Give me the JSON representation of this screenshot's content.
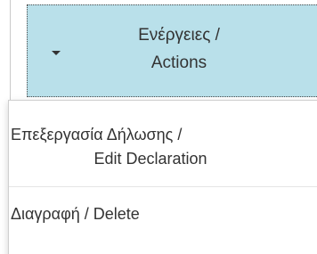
{
  "actions_button": {
    "label_line1": "Ενέργειες /",
    "label_line2": "Actions",
    "caret_icon": "caret-down-icon",
    "background_color": "#b9e0ea"
  },
  "dropdown": {
    "items": [
      {
        "label_line1": "Επεξεργασία Δήλωσης /",
        "label_line2": "Edit Declaration"
      },
      {
        "label_line1": "Διαγραφή / Delete"
      }
    ]
  }
}
